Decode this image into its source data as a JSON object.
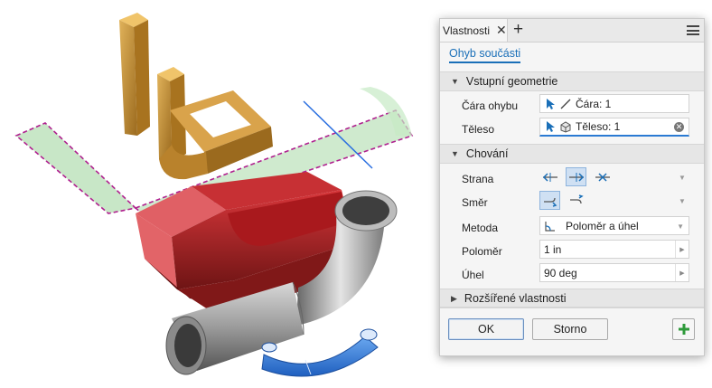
{
  "panel": {
    "tab_label": "Vlastnosti",
    "subtab_label": "Ohyb součásti",
    "sections": {
      "input_geometry": "Vstupní geometrie",
      "behavior": "Chování",
      "advanced": "Rozšířené vlastnosti"
    },
    "rows": {
      "bend_line_label": "Čára ohybu",
      "bend_line_value": "Čára: 1",
      "body_label": "Těleso",
      "body_value": "Těleso: 1",
      "side_label": "Strana",
      "direction_label": "Směr",
      "method_label": "Metoda",
      "method_value": "Poloměr a úhel",
      "radius_label": "Poloměr",
      "radius_value": "1 in",
      "angle_label": "Úhel",
      "angle_value": "90 deg"
    },
    "buttons": {
      "ok": "OK",
      "cancel": "Storno"
    }
  },
  "colors": {
    "accent": "#1a6fb8",
    "selection_bg": "#cfe0f3",
    "add_green": "#2e9a3a",
    "model_gold": "#c8912e",
    "model_red": "#c0282c",
    "model_gray": "#9a9a9a",
    "model_blue": "#3b82d8",
    "preview_green": "#b5dfb4",
    "selection_magenta": "#b0208f"
  },
  "icons": [
    "close-icon",
    "add-tab-icon",
    "menu-icon",
    "select-arrow-icon",
    "line-icon",
    "body-icon",
    "clear-icon",
    "side-icons",
    "direction-icons",
    "method-icon",
    "add-icon"
  ]
}
